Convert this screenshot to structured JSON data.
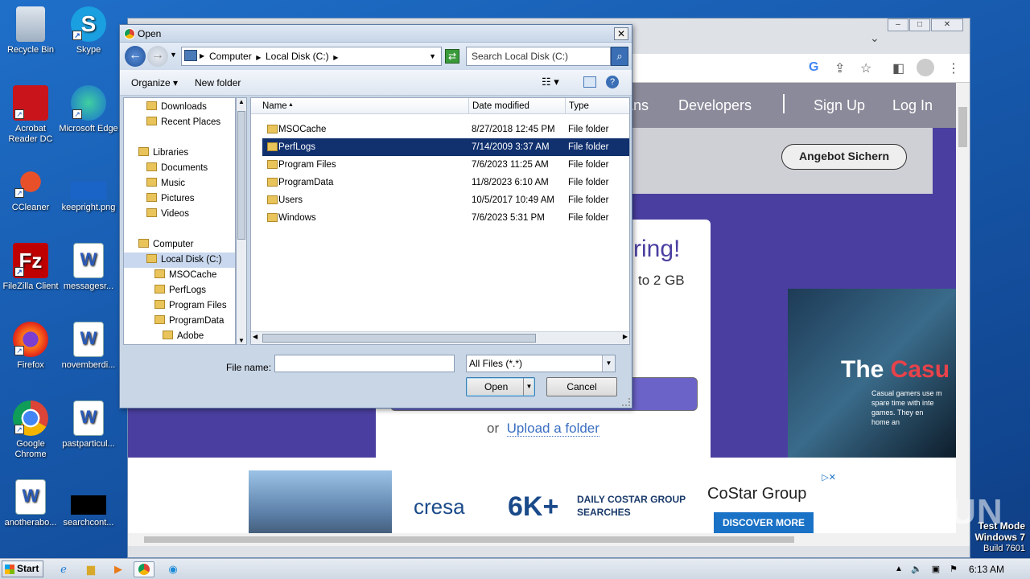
{
  "desktop": {
    "icons": [
      {
        "label": "Recycle Bin"
      },
      {
        "label": "Skype"
      },
      {
        "label": "Acrobat Reader DC"
      },
      {
        "label": "Microsoft Edge"
      },
      {
        "label": "CCleaner"
      },
      {
        "label": "keepright.png"
      },
      {
        "label": "FileZilla Client"
      },
      {
        "label": "messagesr..."
      },
      {
        "label": "Firefox"
      },
      {
        "label": "novemberdi..."
      },
      {
        "label": "Google Chrome"
      },
      {
        "label": "pastparticul..."
      },
      {
        "label": "anotherabo..."
      },
      {
        "label": "searchcont..."
      }
    ]
  },
  "browser": {
    "nav": {
      "item1": "ans",
      "developers": "Developers",
      "signup": "Sign Up",
      "login": "Log In"
    },
    "angebot": "Angebot Sichern",
    "card": {
      "headline": "ring!",
      "sub": "to 2 GB",
      "or": "or",
      "upload_folder": "Upload a folder"
    },
    "ad": {
      "title_white": "The ",
      "title_red": "Casu",
      "sub": "Casual gamers use m\nspare time with inte\ngames. They en\nhome an"
    },
    "banner": {
      "cresa": "cresa",
      "sixk": "6K+",
      "daily": "DAILY COSTAR GROUP\nSEARCHES",
      "costar": "CoStar Group",
      "discover": "DISCOVER MORE"
    }
  },
  "dialog": {
    "title": "Open",
    "breadcrumb": [
      "Computer",
      "Local Disk (C:)"
    ],
    "search_placeholder": "Search Local Disk (C:)",
    "toolbar": {
      "organize": "Organize ▾",
      "new_folder": "New folder"
    },
    "tree": [
      {
        "label": "Downloads",
        "indent": 1
      },
      {
        "label": "Recent Places",
        "indent": 1
      },
      {
        "label": "Libraries",
        "indent": 0
      },
      {
        "label": "Documents",
        "indent": 1
      },
      {
        "label": "Music",
        "indent": 1
      },
      {
        "label": "Pictures",
        "indent": 1
      },
      {
        "label": "Videos",
        "indent": 1
      },
      {
        "label": "Computer",
        "indent": 0
      },
      {
        "label": "Local Disk (C:)",
        "indent": 1,
        "selected": true
      },
      {
        "label": "MSOCache",
        "indent": 2
      },
      {
        "label": "PerfLogs",
        "indent": 2
      },
      {
        "label": "Program Files",
        "indent": 2
      },
      {
        "label": "ProgramData",
        "indent": 2
      },
      {
        "label": "Adobe",
        "indent": 3
      }
    ],
    "columns": {
      "name": "Name",
      "date": "Date modified",
      "type": "Type"
    },
    "files": [
      {
        "name": "MSOCache",
        "date": "8/27/2018 12:45 PM",
        "type": "File folder"
      },
      {
        "name": "PerfLogs",
        "date": "7/14/2009 3:37 AM",
        "type": "File folder",
        "selected": true
      },
      {
        "name": "Program Files",
        "date": "7/6/2023 11:25 AM",
        "type": "File folder"
      },
      {
        "name": "ProgramData",
        "date": "11/8/2023 6:10 AM",
        "type": "File folder"
      },
      {
        "name": "Users",
        "date": "10/5/2017 10:49 AM",
        "type": "File folder"
      },
      {
        "name": "Windows",
        "date": "7/6/2023 5:31 PM",
        "type": "File folder"
      }
    ],
    "file_name_label": "File name:",
    "file_name_value": "",
    "file_type": "All Files (*.*)",
    "open_label": "Open",
    "cancel_label": "Cancel"
  },
  "taskbar": {
    "start": "Start",
    "clock": "6:13 AM"
  },
  "watermark": {
    "line1": "Test Mode",
    "line2": "Windows 7",
    "line3": "Build 7601",
    "anyrun": "ANY RUN"
  }
}
